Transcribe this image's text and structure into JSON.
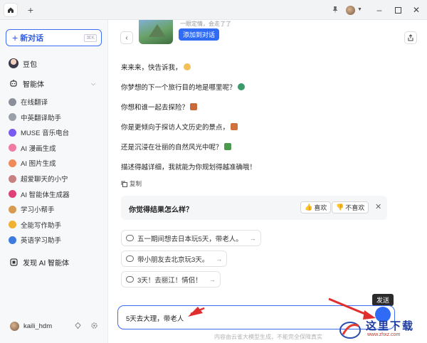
{
  "titlebar": {
    "home_icon": "home-icon",
    "new_tab": "+",
    "pin_icon": "pin-icon",
    "window_controls": [
      "minimize-icon",
      "maximize-icon",
      "close-icon"
    ]
  },
  "sidebar": {
    "new_chat_label": "新对话",
    "new_chat_shortcut": "⌘K",
    "doubao_label": "豆包",
    "agents_label": "智能体",
    "agents": [
      {
        "label": "在线翻译",
        "color": "#8a8f99"
      },
      {
        "label": "中英翻译助手",
        "color": "#9aa0aa"
      },
      {
        "label": "MUSE 音乐电台",
        "color": "#7a5af0"
      },
      {
        "label": "AI 漫画生成",
        "color": "#f07aa0"
      },
      {
        "label": "AI 图片生成",
        "color": "#f08a5a"
      },
      {
        "label": "超爱聊天的小宁",
        "color": "#c88080"
      },
      {
        "label": "AI 智能体生成器",
        "color": "#e0407a"
      },
      {
        "label": "学习小帮手",
        "color": "#d89a50"
      },
      {
        "label": "全能写作助手",
        "color": "#f0b030"
      },
      {
        "label": "英语学习助手",
        "color": "#3c7ae0"
      }
    ],
    "discover_label": "发现 AI 智能体",
    "username": "kaili_hdm"
  },
  "main": {
    "add_to_chat": "添加到对话",
    "hero_subtitle": "一眼定情，会走了了",
    "messages": [
      "来来来，快告诉我，",
      "你梦想的下一个旅行目的地是哪里呢？",
      "你想和谁一起去探险？",
      "你是更倾向于探访人文历史的景点，",
      "还是沉浸在壮丽的自然风光中呢？",
      "描述得越详细，我就能为你规划得越准确哦！"
    ],
    "copy_label": "复制",
    "feedback_question": "你觉得结果怎么样？",
    "like_label": "喜欢",
    "dislike_label": "不喜欢",
    "suggestions": [
      "五一期间想去日本玩5天，带老人。",
      "带小朋友去北京玩3天。",
      "3天！去丽江！情侣！"
    ],
    "send_tooltip": "发送",
    "input_value": "5天去大理，带老人",
    "disclaimer": "内容由云雀大模型生成，不能完全保障真实"
  },
  "watermark": {
    "main": "这里下载",
    "sub": "www.zhxz.com"
  },
  "colors": {
    "accent": "#2f6bf5",
    "arrow": "#e02d2d"
  }
}
